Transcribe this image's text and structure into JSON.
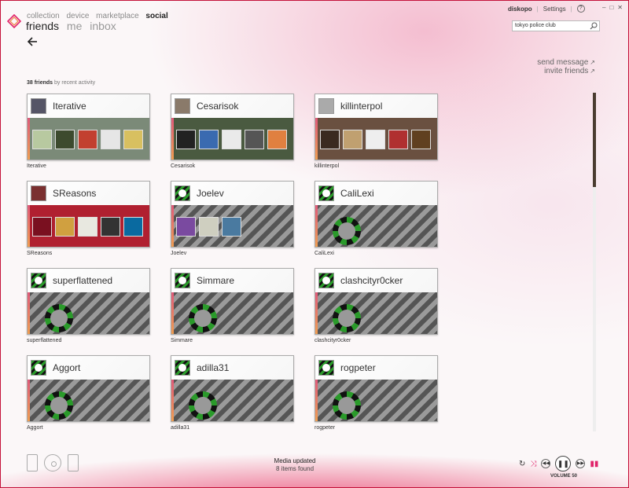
{
  "nav": {
    "pivots": [
      "collection",
      "device",
      "marketplace",
      "social"
    ],
    "active_pivot": "social",
    "subpivots": [
      "friends",
      "me",
      "inbox"
    ],
    "active_subpivot": "friends"
  },
  "user": {
    "name": "diskopo",
    "settings": "Settings"
  },
  "search": {
    "value": "tokyo police club"
  },
  "actions": {
    "send_message": "send message",
    "invite_friends": "invite friends"
  },
  "friends_count": {
    "count": "38 friends",
    "sort": "by recent activity"
  },
  "friends": [
    {
      "name": "Iterative",
      "has_photo": true
    },
    {
      "name": "Cesarisok",
      "has_photo": true
    },
    {
      "name": "killinterpol",
      "has_photo": true
    },
    {
      "name": "SReasons",
      "has_photo": true
    },
    {
      "name": "Joelev",
      "has_photo": false
    },
    {
      "name": "CaliLexi",
      "has_photo": false
    },
    {
      "name": "superflattened",
      "has_photo": false
    },
    {
      "name": "Simmare",
      "has_photo": false
    },
    {
      "name": "clashcityr0cker",
      "has_photo": false
    },
    {
      "name": "Aggort",
      "has_photo": false
    },
    {
      "name": "adilla31",
      "has_photo": false
    },
    {
      "name": "rogpeter",
      "has_photo": false
    }
  ],
  "status": {
    "title": "Media updated",
    "detail": "8 items found"
  },
  "player": {
    "volume": "VOLUME 50"
  },
  "colors": {
    "brand": "#e0246a",
    "accent_bar": "#e05a7a"
  }
}
